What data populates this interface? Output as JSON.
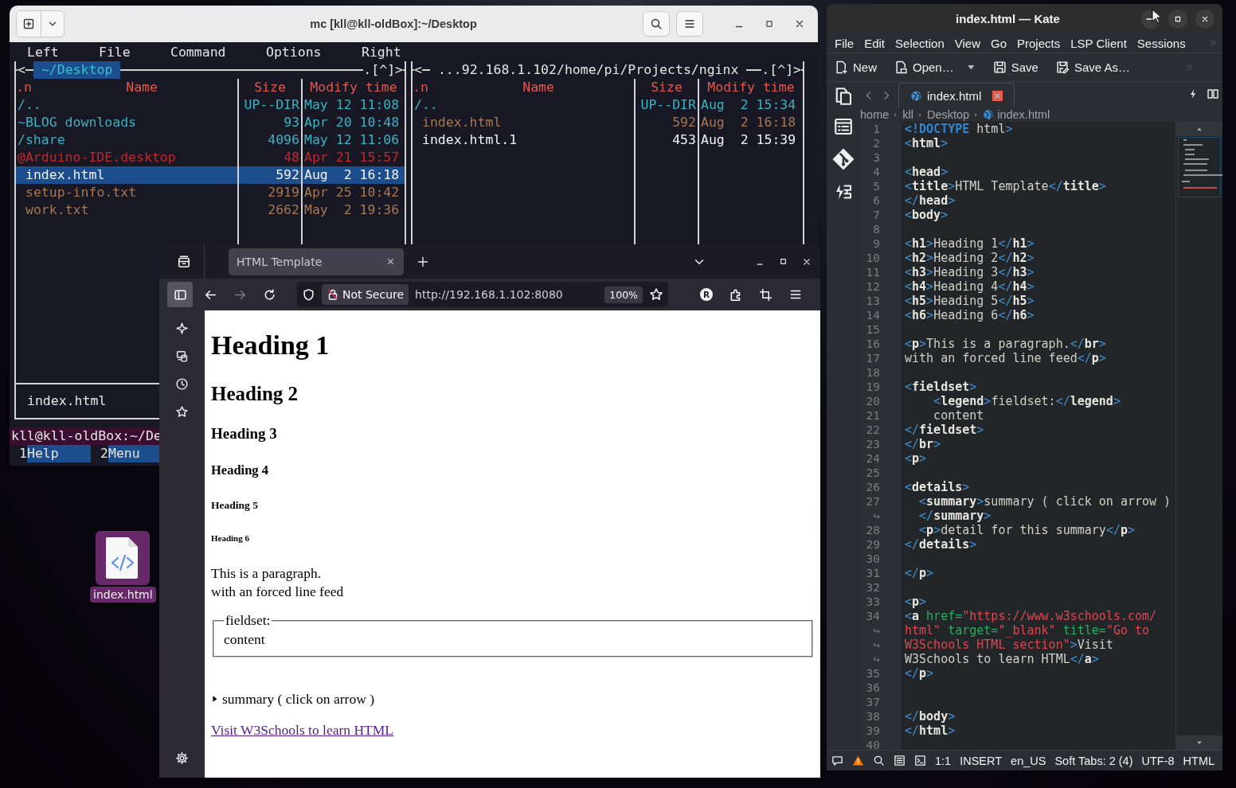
{
  "terminal": {
    "title": "mc [kll@kll-oldBox]:~/Desktop",
    "menu": [
      "Left",
      "File",
      "Command",
      "Options",
      "Right"
    ],
    "panels": [
      {
        "corner_left": "<",
        "path": "~/Desktop",
        "active": true,
        "corner_right": ".[^]>",
        "columns": [
          ".n",
          "Name",
          "Size",
          "Modify time"
        ],
        "rows": [
          {
            "kind": "directory",
            "name": "/..",
            "size": "UP--DIR",
            "modified": "May 12 11:08",
            "color": "#35b4c6",
            "selected": false
          },
          {
            "kind": "directory",
            "name": "~BLOG downloads",
            "size": "93",
            "modified": "Apr 20 10:48",
            "color": "#35b4c6",
            "selected": false
          },
          {
            "kind": "directory",
            "name": "/share",
            "size": "4096",
            "modified": "May 12 11:06",
            "color": "#35b4c6",
            "selected": false
          },
          {
            "kind": "link",
            "name": "@Arduino-IDE.desktop",
            "size": "48",
            "modified": "Apr 21 15:57",
            "color": "#c8262b",
            "selected": false
          },
          {
            "kind": "file",
            "name": "index.html",
            "size": "592",
            "modified": "Aug  2 16:18",
            "color": "#f2f2f2",
            "selected": true
          },
          {
            "kind": "file",
            "name": "setup-info.txt",
            "size": "2919",
            "modified": "Apr 25 10:42",
            "color": "#a87850",
            "selected": false
          },
          {
            "kind": "file",
            "name": "work.txt",
            "size": "2662",
            "modified": "May  2 19:36",
            "color": "#a87850",
            "selected": false
          }
        ],
        "mini_status": "index.html"
      },
      {
        "corner_left": "<",
        "path": "...92.168.1.102/home/pi/Projects/nginx",
        "active": false,
        "corner_right": ".[^]>",
        "columns": [
          ".n",
          "Name",
          "Size",
          "Modify time"
        ],
        "rows": [
          {
            "kind": "directory",
            "name": "/..",
            "size": "UP--DIR",
            "modified": "Aug  2 15:34",
            "color": "#35b4c6",
            "selected": false
          },
          {
            "kind": "file",
            "name": "index.html",
            "size": "592",
            "modified": "Aug  2 16:18",
            "color": "#a87850",
            "selected": false
          },
          {
            "kind": "file",
            "name": "index.html.1",
            "size": "453",
            "modified": "Aug  2 15:39",
            "color": "#f2f2f2",
            "selected": false
          }
        ]
      }
    ],
    "prompt": "kll@kll-oldBox:~/De",
    "function_keys": [
      {
        "number": "1",
        "label": "Help"
      },
      {
        "number": "2",
        "label": "Menu"
      }
    ]
  },
  "desktop_icons": [
    {
      "label": "index.html",
      "selected": true
    }
  ],
  "browser": {
    "tabs": [
      {
        "title": "HTML Template",
        "selected": true
      }
    ],
    "sidebar_open": true,
    "back": {
      "disabled": false
    },
    "forward": {
      "disabled": true
    },
    "security": "Not Secure",
    "url": "http://192.168.1.102:8080",
    "zoom": "100%",
    "extension_badge": "R",
    "page": {
      "headings": [
        {
          "kind": "h1",
          "text": "Heading 1"
        },
        {
          "kind": "h2",
          "text": "Heading 2"
        },
        {
          "kind": "h3",
          "text": "Heading 3"
        },
        {
          "kind": "h4",
          "text": "Heading 4"
        },
        {
          "kind": "h5",
          "text": "Heading 5"
        },
        {
          "kind": "h6",
          "text": "Heading 6"
        }
      ],
      "paragraph_lines": [
        "This is a paragraph.",
        "with an forced line feed"
      ],
      "fieldset": {
        "legend": "fieldset:",
        "content": "content"
      },
      "details": {
        "summary": "summary ( click on arrow )",
        "expanded": false
      },
      "link": {
        "text": "Visit W3Schools to learn HTML",
        "visited": true
      }
    }
  },
  "editor": {
    "title": "index.html — Kate",
    "menu": [
      "File",
      "Edit",
      "Selection",
      "View",
      "Go",
      "Projects",
      "LSP Client",
      "Sessions"
    ],
    "toolbar": [
      {
        "kind": "new",
        "label": "New",
        "dropdown": false
      },
      {
        "kind": "open",
        "label": "Open…",
        "dropdown": true
      },
      {
        "kind": "save",
        "label": "Save",
        "dropdown": false
      },
      {
        "kind": "save_as",
        "label": "Save As…",
        "dropdown": false
      }
    ],
    "tabs": [
      {
        "title": "index.html",
        "selected": true
      }
    ],
    "breadcrumbs": [
      "home",
      "kll",
      "Desktop",
      "index.html"
    ],
    "lines": [
      {
        "number": "1",
        "tokens": [
          {
            "kind": "doctype",
            "text": "<!DOCTYPE"
          },
          {
            "kind": "text",
            "text": " html"
          },
          {
            "kind": "punct",
            "text": ">"
          }
        ]
      },
      {
        "number": "2",
        "tokens": [
          {
            "kind": "punct",
            "text": "<"
          },
          {
            "kind": "tag",
            "text": "html"
          },
          {
            "kind": "punct",
            "text": ">"
          }
        ]
      },
      {
        "number": "3"
      },
      {
        "number": "4",
        "tokens": [
          {
            "kind": "punct",
            "text": "<"
          },
          {
            "kind": "tag",
            "text": "head"
          },
          {
            "kind": "punct",
            "text": ">"
          }
        ]
      },
      {
        "number": "5",
        "tokens": [
          {
            "kind": "punct",
            "text": "<"
          },
          {
            "kind": "tag",
            "text": "title"
          },
          {
            "kind": "punct",
            "text": ">"
          },
          {
            "kind": "text",
            "text": "HTML Template"
          },
          {
            "kind": "punct",
            "text": "</"
          },
          {
            "kind": "tag",
            "text": "title"
          },
          {
            "kind": "punct",
            "text": ">"
          }
        ]
      },
      {
        "number": "6",
        "tokens": [
          {
            "kind": "punct",
            "text": "</"
          },
          {
            "kind": "tag",
            "text": "head"
          },
          {
            "kind": "punct",
            "text": ">"
          }
        ]
      },
      {
        "number": "7",
        "tokens": [
          {
            "kind": "punct",
            "text": "<"
          },
          {
            "kind": "tag",
            "text": "body"
          },
          {
            "kind": "punct",
            "text": ">"
          }
        ]
      },
      {
        "number": "8"
      },
      {
        "number": "9",
        "tokens": [
          {
            "kind": "punct",
            "text": "<"
          },
          {
            "kind": "tag",
            "text": "h1"
          },
          {
            "kind": "punct",
            "text": ">"
          },
          {
            "kind": "text",
            "text": "Heading 1"
          },
          {
            "kind": "punct",
            "text": "</"
          },
          {
            "kind": "tag",
            "text": "h1"
          },
          {
            "kind": "punct",
            "text": ">"
          }
        ]
      },
      {
        "number": "10",
        "tokens": [
          {
            "kind": "punct",
            "text": "<"
          },
          {
            "kind": "tag",
            "text": "h2"
          },
          {
            "kind": "punct",
            "text": ">"
          },
          {
            "kind": "text",
            "text": "Heading 2"
          },
          {
            "kind": "punct",
            "text": "</"
          },
          {
            "kind": "tag",
            "text": "h2"
          },
          {
            "kind": "punct",
            "text": ">"
          }
        ]
      },
      {
        "number": "11",
        "tokens": [
          {
            "kind": "punct",
            "text": "<"
          },
          {
            "kind": "tag",
            "text": "h3"
          },
          {
            "kind": "punct",
            "text": ">"
          },
          {
            "kind": "text",
            "text": "Heading 3"
          },
          {
            "kind": "punct",
            "text": "</"
          },
          {
            "kind": "tag",
            "text": "h3"
          },
          {
            "kind": "punct",
            "text": ">"
          }
        ]
      },
      {
        "number": "12",
        "tokens": [
          {
            "kind": "punct",
            "text": "<"
          },
          {
            "kind": "tag",
            "text": "h4"
          },
          {
            "kind": "punct",
            "text": ">"
          },
          {
            "kind": "text",
            "text": "Heading 4"
          },
          {
            "kind": "punct",
            "text": "</"
          },
          {
            "kind": "tag",
            "text": "h4"
          },
          {
            "kind": "punct",
            "text": ">"
          }
        ]
      },
      {
        "number": "13",
        "tokens": [
          {
            "kind": "punct",
            "text": "<"
          },
          {
            "kind": "tag",
            "text": "h5"
          },
          {
            "kind": "punct",
            "text": ">"
          },
          {
            "kind": "text",
            "text": "Heading 5"
          },
          {
            "kind": "punct",
            "text": "</"
          },
          {
            "kind": "tag",
            "text": "h5"
          },
          {
            "kind": "punct",
            "text": ">"
          }
        ]
      },
      {
        "number": "14",
        "tokens": [
          {
            "kind": "punct",
            "text": "<"
          },
          {
            "kind": "tag",
            "text": "h6"
          },
          {
            "kind": "punct",
            "text": ">"
          },
          {
            "kind": "text",
            "text": "Heading 6"
          },
          {
            "kind": "punct",
            "text": "</"
          },
          {
            "kind": "tag",
            "text": "h6"
          },
          {
            "kind": "punct",
            "text": ">"
          }
        ]
      },
      {
        "number": "15"
      },
      {
        "number": "16",
        "tokens": [
          {
            "kind": "punct",
            "text": "<"
          },
          {
            "kind": "tag",
            "text": "p"
          },
          {
            "kind": "punct",
            "text": ">"
          },
          {
            "kind": "text",
            "text": "This is a paragraph."
          },
          {
            "kind": "punct",
            "text": "</"
          },
          {
            "kind": "tag",
            "text": "br"
          },
          {
            "kind": "punct",
            "text": ">"
          }
        ]
      },
      {
        "number": "17",
        "tokens": [
          {
            "kind": "text",
            "text": "with an forced line feed"
          },
          {
            "kind": "punct",
            "text": "</"
          },
          {
            "kind": "tag",
            "text": "p"
          },
          {
            "kind": "punct",
            "text": ">"
          }
        ]
      },
      {
        "number": "18"
      },
      {
        "number": "19",
        "tokens": [
          {
            "kind": "punct",
            "text": "<"
          },
          {
            "kind": "tag",
            "text": "fieldset"
          },
          {
            "kind": "punct",
            "text": ">"
          }
        ]
      },
      {
        "number": "20",
        "tokens": [
          {
            "kind": "punct",
            "text": "    <"
          },
          {
            "kind": "tag",
            "text": "legend"
          },
          {
            "kind": "punct",
            "text": ">"
          },
          {
            "kind": "text",
            "text": "fieldset:"
          },
          {
            "kind": "punct",
            "text": "</"
          },
          {
            "kind": "tag",
            "text": "legend"
          },
          {
            "kind": "punct",
            "text": ">"
          }
        ]
      },
      {
        "number": "21",
        "tokens": [
          {
            "kind": "text",
            "text": "    content"
          }
        ]
      },
      {
        "number": "22",
        "tokens": [
          {
            "kind": "punct",
            "text": "</"
          },
          {
            "kind": "tag",
            "text": "fieldset"
          },
          {
            "kind": "punct",
            "text": ">"
          }
        ]
      },
      {
        "number": "23",
        "tokens": [
          {
            "kind": "punct",
            "text": "</"
          },
          {
            "kind": "tag",
            "text": "br"
          },
          {
            "kind": "punct",
            "text": ">"
          }
        ]
      },
      {
        "number": "24",
        "tokens": [
          {
            "kind": "punct",
            "text": "<"
          },
          {
            "kind": "tag",
            "text": "p"
          },
          {
            "kind": "punct",
            "text": ">"
          }
        ]
      },
      {
        "number": "25"
      },
      {
        "number": "26",
        "tokens": [
          {
            "kind": "punct",
            "text": "<"
          },
          {
            "kind": "tag",
            "text": "details"
          },
          {
            "kind": "punct",
            "text": ">"
          }
        ]
      },
      {
        "number": "27",
        "tokens": [
          {
            "kind": "punct",
            "text": "  <"
          },
          {
            "kind": "tag",
            "text": "summary"
          },
          {
            "kind": "punct",
            "text": ">"
          },
          {
            "kind": "text",
            "text": "summary ( click on arrow )"
          }
        ]
      },
      {
        "number": "↪",
        "tokens": [
          {
            "kind": "punct",
            "text": "  </"
          },
          {
            "kind": "tag",
            "text": "summary"
          },
          {
            "kind": "punct",
            "text": ">"
          }
        ]
      },
      {
        "number": "28",
        "tokens": [
          {
            "kind": "punct",
            "text": "  <"
          },
          {
            "kind": "tag",
            "text": "p"
          },
          {
            "kind": "punct",
            "text": ">"
          },
          {
            "kind": "text",
            "text": "detail for this summary"
          },
          {
            "kind": "punct",
            "text": "</"
          },
          {
            "kind": "tag",
            "text": "p"
          },
          {
            "kind": "punct",
            "text": ">"
          }
        ]
      },
      {
        "number": "29",
        "tokens": [
          {
            "kind": "punct",
            "text": "</"
          },
          {
            "kind": "tag",
            "text": "details"
          },
          {
            "kind": "punct",
            "text": ">"
          }
        ]
      },
      {
        "number": "30"
      },
      {
        "number": "31",
        "tokens": [
          {
            "kind": "punct",
            "text": "</"
          },
          {
            "kind": "tag",
            "text": "p"
          },
          {
            "kind": "punct",
            "text": ">"
          }
        ]
      },
      {
        "number": "32"
      },
      {
        "number": "33",
        "tokens": [
          {
            "kind": "punct",
            "text": "<"
          },
          {
            "kind": "tag",
            "text": "p"
          },
          {
            "kind": "punct",
            "text": ">"
          }
        ]
      },
      {
        "number": "34",
        "tokens": [
          {
            "kind": "punct",
            "text": "<"
          },
          {
            "kind": "tag",
            "text": "a"
          },
          {
            "kind": "attr",
            "text": " href="
          },
          {
            "kind": "string",
            "text": "\"https://www.w3schools.com/"
          }
        ]
      },
      {
        "number": "↪",
        "tokens": [
          {
            "kind": "string",
            "text": "html\""
          },
          {
            "kind": "attr",
            "text": " target="
          },
          {
            "kind": "string",
            "text": "\"_blank\""
          },
          {
            "kind": "attr",
            "text": " title="
          },
          {
            "kind": "string",
            "text": "\"Go to"
          }
        ]
      },
      {
        "number": "↪",
        "tokens": [
          {
            "kind": "string",
            "text": "W3Schools HTML section\""
          },
          {
            "kind": "punct",
            "text": ">"
          },
          {
            "kind": "text",
            "text": "Visit"
          }
        ]
      },
      {
        "number": "↪",
        "tokens": [
          {
            "kind": "text",
            "text": "W3Schools to learn HTML"
          },
          {
            "kind": "punct",
            "text": "</"
          },
          {
            "kind": "tag",
            "text": "a"
          },
          {
            "kind": "punct",
            "text": ">"
          }
        ]
      },
      {
        "number": "35",
        "tokens": [
          {
            "kind": "punct",
            "text": "</"
          },
          {
            "kind": "tag",
            "text": "p"
          },
          {
            "kind": "punct",
            "text": ">"
          }
        ]
      },
      {
        "number": "36"
      },
      {
        "number": "37"
      },
      {
        "number": "38",
        "tokens": [
          {
            "kind": "punct",
            "text": "</"
          },
          {
            "kind": "tag",
            "text": "body"
          },
          {
            "kind": "punct",
            "text": ">"
          }
        ]
      },
      {
        "number": "39",
        "tokens": [
          {
            "kind": "punct",
            "text": "</"
          },
          {
            "kind": "tag",
            "text": "html"
          },
          {
            "kind": "punct",
            "text": ">"
          }
        ]
      },
      {
        "number": "40"
      }
    ],
    "status": [
      "1:1",
      "INSERT",
      "en_US",
      "Soft Tabs: 2 (4)",
      "UTF-8",
      "HTML"
    ]
  }
}
